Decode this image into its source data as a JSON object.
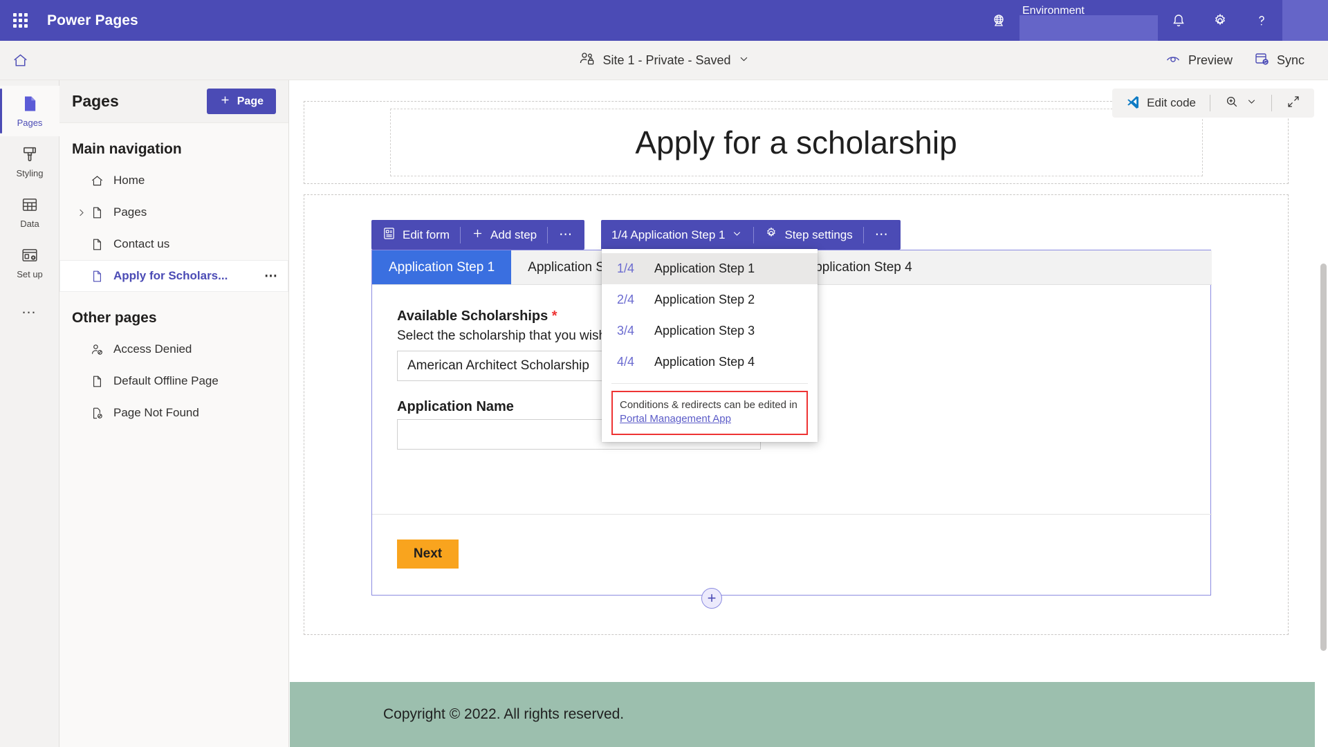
{
  "suite": {
    "app_title": "Power Pages",
    "waffle_icon": "waffle-grid-icon",
    "environment_label": "Environment",
    "environment_value": "",
    "notifications_icon": "bell-icon",
    "settings_icon": "gear-icon",
    "help_icon": "question-mark-icon",
    "globe_icon": "globe-icon",
    "brand_color": "#4b4bb5"
  },
  "command_bar": {
    "home_icon": "home-icon",
    "site_status": "Site 1 - Private - Saved",
    "site_icon": "people-lock-icon",
    "site_chevron": "chevron-down-icon",
    "preview_label": "Preview",
    "preview_icon": "preview-eye-icon",
    "sync_label": "Sync",
    "sync_icon": "sync-icon"
  },
  "rail": {
    "items": [
      {
        "label": "Pages",
        "icon": "page-icon",
        "active": true
      },
      {
        "label": "Styling",
        "icon": "paintbrush-icon",
        "active": false
      },
      {
        "label": "Data",
        "icon": "table-icon",
        "active": false
      },
      {
        "label": "Set up",
        "icon": "setup-gear-icon",
        "active": false
      }
    ],
    "more_label": "…"
  },
  "panel": {
    "title": "Pages",
    "add_page_label": "Page",
    "add_page_icon": "plus-icon",
    "main_nav_title": "Main navigation",
    "main_nav": [
      {
        "label": "Home",
        "icon": "home-outline-icon",
        "expandable": false,
        "selected": false,
        "overflow": false
      },
      {
        "label": "Pages",
        "icon": "file-icon",
        "expandable": true,
        "selected": false,
        "overflow": false
      },
      {
        "label": "Contact us",
        "icon": "file-icon",
        "expandable": false,
        "selected": false,
        "overflow": false
      },
      {
        "label": "Apply for Scholars...",
        "icon": "file-icon",
        "expandable": false,
        "selected": true,
        "overflow": true
      }
    ],
    "other_pages_title": "Other pages",
    "other_pages": [
      {
        "label": "Access Denied",
        "icon": "person-blocked-icon"
      },
      {
        "label": "Default Offline Page",
        "icon": "file-icon"
      },
      {
        "label": "Page Not Found",
        "icon": "file-blocked-icon"
      }
    ],
    "overflow_glyph": "⋯"
  },
  "canvas_toolbar": {
    "edit_code_label": "Edit code",
    "edit_code_icon": "vscode-icon",
    "zoom_icon": "magnifier-plus-icon",
    "zoom_chevron": "chevron-down-icon",
    "fullscreen_icon": "expand-arrows-icon"
  },
  "page": {
    "hero_title": "Apply for a scholarship",
    "footer_text": "Copyright © 2022. All rights reserved.",
    "add_section_glyph": "+"
  },
  "form_toolbar_left": {
    "edit_form_label": "Edit form",
    "edit_form_icon": "form-icon",
    "add_step_label": "Add step",
    "add_step_icon": "plus-icon",
    "overflow_glyph": "⋯"
  },
  "form_toolbar_right": {
    "step_selector_label": "1/4 Application Step 1",
    "step_chevron": "chevron-down-icon",
    "step_settings_label": "Step settings",
    "step_settings_icon": "gear-icon",
    "overflow_glyph": "⋯"
  },
  "step_menu": {
    "items": [
      {
        "num": "1/4",
        "label": "Application Step 1",
        "highlight": true
      },
      {
        "num": "2/4",
        "label": "Application Step 2",
        "highlight": false
      },
      {
        "num": "3/4",
        "label": "Application Step 3",
        "highlight": false
      },
      {
        "num": "4/4",
        "label": "Application Step 4",
        "highlight": false
      }
    ],
    "note_text": "Conditions & redirects can be edited in",
    "note_link": "Portal Management App",
    "note_border_color": "#ee3333"
  },
  "form": {
    "tabs": [
      {
        "label": "Application Step 1",
        "active": true
      },
      {
        "label": "Application Step 2",
        "active": false
      },
      {
        "label": "Application Step 3",
        "active": false
      },
      {
        "label": "Application Step 4",
        "active": false
      }
    ],
    "fields": [
      {
        "label": "Available Scholarships",
        "required": true,
        "required_glyph": "*",
        "help": "Select the scholarship that you wish to apply for",
        "value": "American Architect Scholarship"
      },
      {
        "label": "Application Name",
        "required": false,
        "required_glyph": "",
        "help": "",
        "value": ""
      }
    ],
    "next_label": "Next",
    "next_color": "#f9a41e"
  }
}
